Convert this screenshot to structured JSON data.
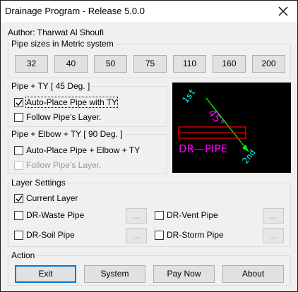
{
  "window": {
    "title": "Drainage Program - Release 5.0.0"
  },
  "author": "Author: Tharwat Al Shoufi",
  "pipe_sizes": {
    "legend": "Pipe sizes in Metric system",
    "buttons": [
      "32",
      "40",
      "50",
      "75",
      "110",
      "160",
      "200"
    ]
  },
  "pipe_ty": {
    "legend": "Pipe + TY [ 45 Deg. ]",
    "auto_place": {
      "label": "Auto-Place Pipe with TY",
      "checked": true
    },
    "follow_layer": {
      "label": "Follow Pipe's Layer.",
      "checked": false
    }
  },
  "pipe_elbow": {
    "legend": "Pipe + Elbow + TY [ 90 Deg. ]",
    "auto_place": {
      "label": "Auto-Place Pipe + Elbow + TY",
      "checked": false
    },
    "follow_layer": {
      "label": "Follow Pipe's Layer.",
      "checked": false,
      "disabled": true
    }
  },
  "preview": {
    "label_1st": "1st",
    "label_45": "45°",
    "label_2nd": "2nd",
    "label_pipe": "DR—PIPE",
    "colors": {
      "text_green": "#00ffff",
      "magenta": "#ff00ff",
      "red": "#ff0000",
      "green": "#00ff00"
    }
  },
  "layer_settings": {
    "legend": "Layer Settings",
    "current_layer": {
      "label": "Current Layer",
      "checked": true
    },
    "items": [
      {
        "label": "DR-Waste Pipe",
        "checked": false,
        "button": "..."
      },
      {
        "label": "DR-Vent Pipe",
        "checked": false,
        "button": "..."
      },
      {
        "label": "DR-Soil Pipe",
        "checked": false,
        "button": "..."
      },
      {
        "label": "DR-Storm Pipe",
        "checked": false,
        "button": "..."
      }
    ]
  },
  "action": {
    "legend": "Action",
    "buttons": [
      "Exit",
      "System",
      "Pay Now",
      "About"
    ]
  }
}
